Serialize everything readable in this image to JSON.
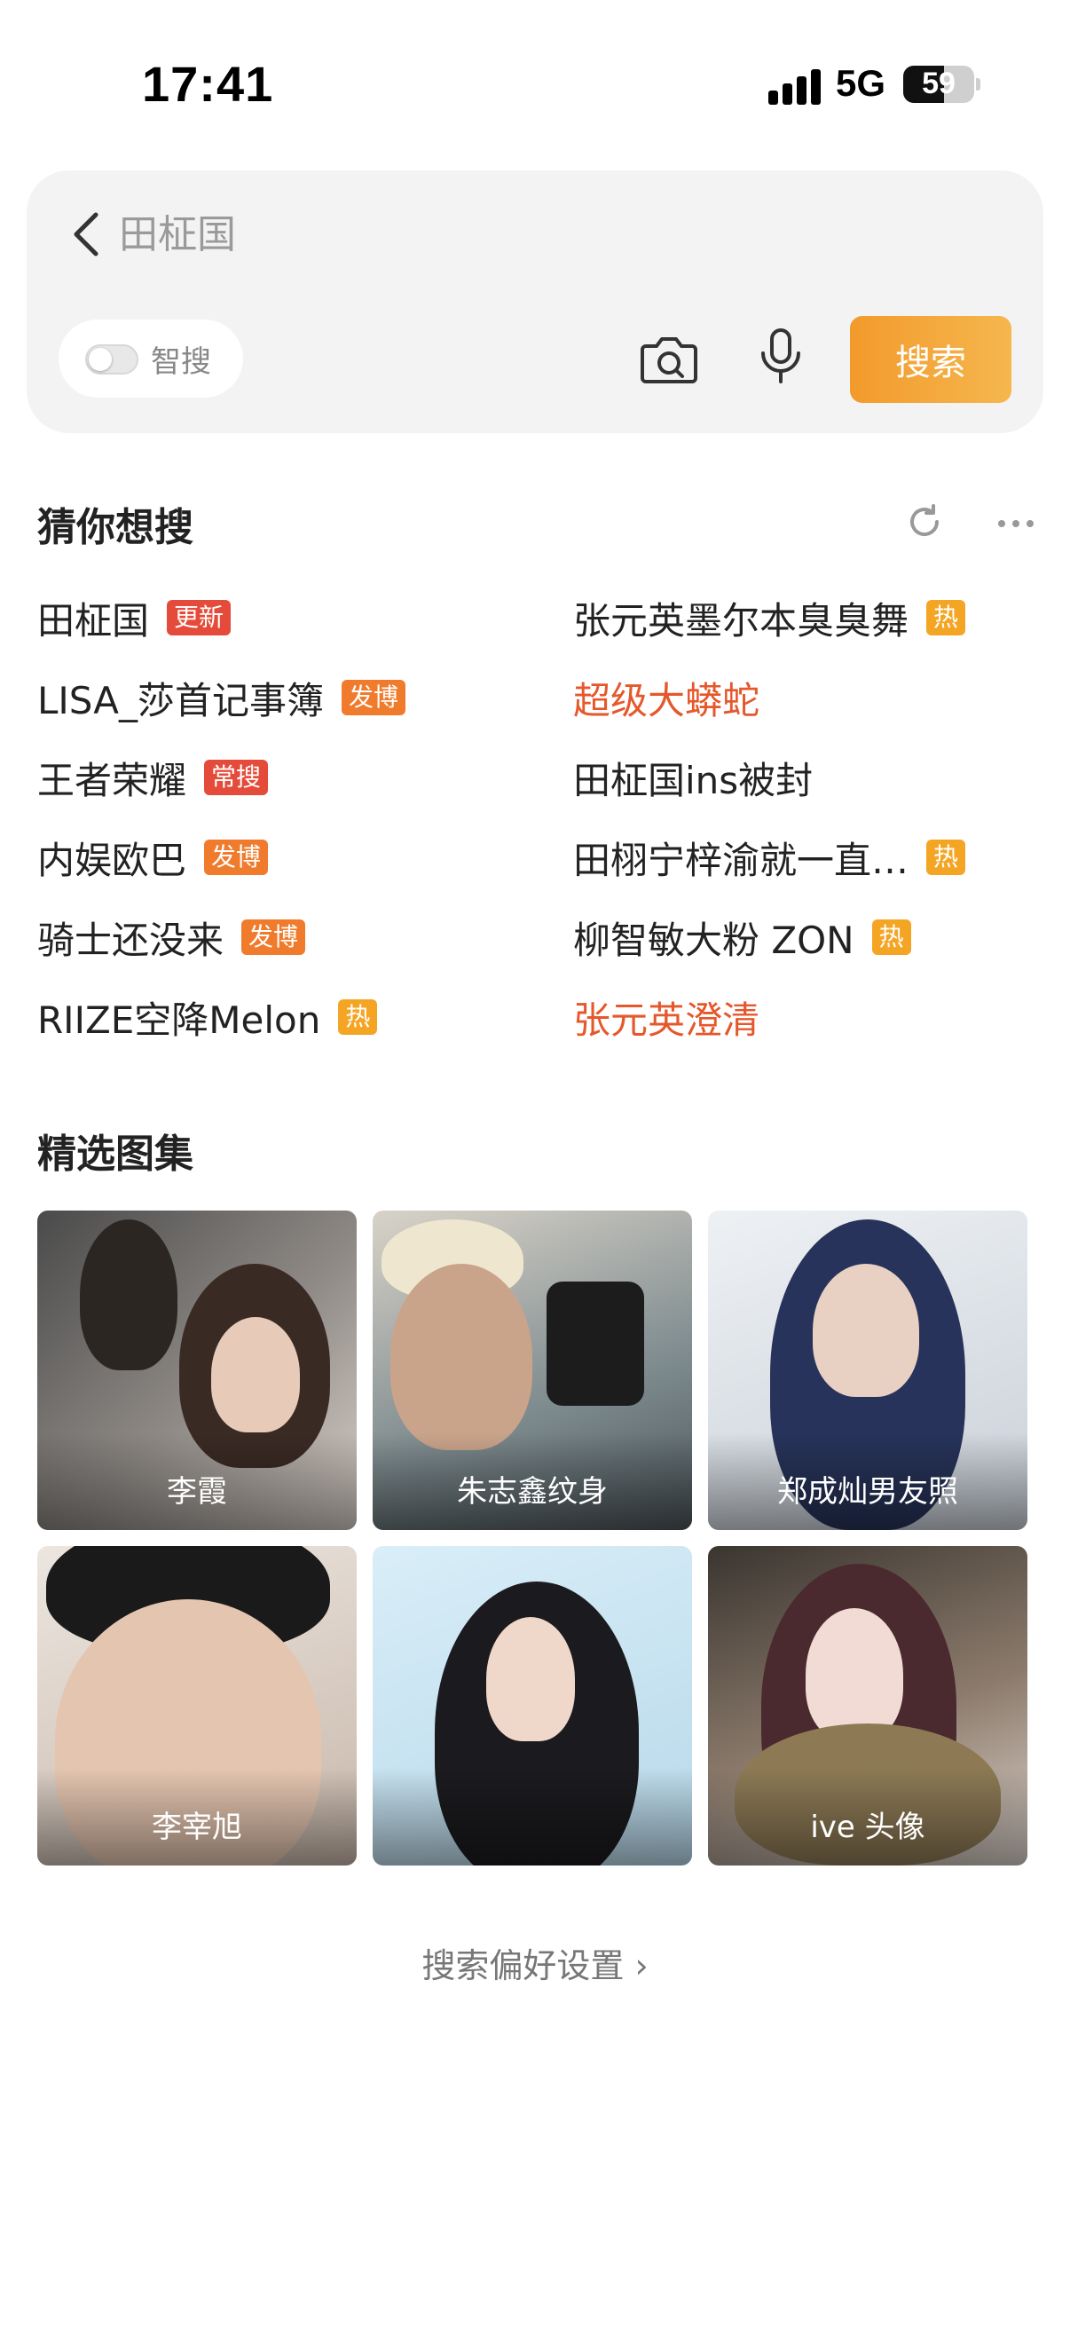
{
  "status_bar": {
    "time": "17:41",
    "network": "5G",
    "battery": "59"
  },
  "search": {
    "placeholder": "田柾国",
    "ai_toggle_label": "智搜",
    "button_label": "搜索"
  },
  "guess": {
    "title": "猜你想搜",
    "left": [
      {
        "text": "田柾国",
        "badge": "更新",
        "badge_color": "#e54b3a"
      },
      {
        "text": "LISA_莎首记事簿",
        "badge": "发博",
        "badge_color": "#f07b2c"
      },
      {
        "text": "王者荣耀",
        "badge": "常搜",
        "badge_color": "#e54b3a"
      },
      {
        "text": "内娱欧巴",
        "badge": "发博",
        "badge_color": "#f07b2c"
      },
      {
        "text": "骑士还没来",
        "badge": "发博",
        "badge_color": "#f07b2c"
      },
      {
        "text": "RIIZE空降Melon",
        "badge": "热",
        "badge_color": "#f5a524"
      }
    ],
    "right": [
      {
        "text": "张元英墨尔本臭臭舞",
        "badge": "热",
        "badge_color": "#f5a524",
        "highlight": false
      },
      {
        "text": "超级大蟒蛇",
        "badge": "",
        "badge_color": "",
        "highlight": true
      },
      {
        "text": "田柾国ins被封",
        "badge": "",
        "badge_color": "",
        "highlight": false
      },
      {
        "text": "田栩宁梓渝就一直…",
        "badge": "热",
        "badge_color": "#f5a524",
        "highlight": false
      },
      {
        "text": "柳智敏大粉 ZON",
        "badge": "热",
        "badge_color": "#f5a524",
        "highlight": false
      },
      {
        "text": "张元英澄清",
        "badge": "",
        "badge_color": "",
        "highlight": true
      }
    ]
  },
  "gallery": {
    "title": "精选图集",
    "items": [
      {
        "caption": "李霞"
      },
      {
        "caption": "朱志鑫纹身"
      },
      {
        "caption": "郑成灿男友照"
      },
      {
        "caption": "李宰旭"
      },
      {
        "caption": ""
      },
      {
        "caption": "ive 头像"
      }
    ]
  },
  "footer": {
    "preferences_link": "搜索偏好设置 ›"
  },
  "colors": {
    "accent": "#f39a2c",
    "highlight_text": "#e5582b"
  }
}
